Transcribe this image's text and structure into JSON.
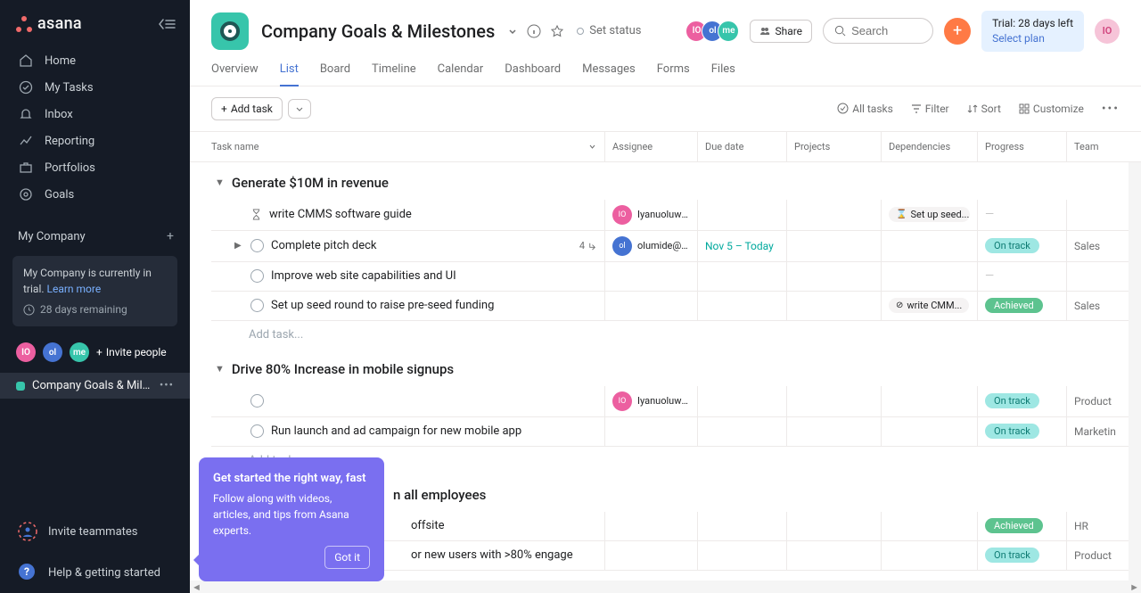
{
  "logo": "asana",
  "nav": {
    "home": "Home",
    "mytasks": "My Tasks",
    "inbox": "Inbox",
    "reporting": "Reporting",
    "portfolios": "Portfolios",
    "goals": "Goals"
  },
  "workspace": {
    "name": "My Company",
    "trial_msg": "My Company is currently in trial. ",
    "learn_more": "Learn more",
    "remaining": "28 days remaining",
    "project": "Company Goals & Mile..."
  },
  "members": [
    {
      "initials": "IO",
      "cls": "av-io"
    },
    {
      "initials": "ol",
      "cls": "av-ol"
    },
    {
      "initials": "me",
      "cls": "av-me"
    }
  ],
  "invite_people": "Invite people",
  "bottom": {
    "invite": "Invite teammates",
    "help": "Help & getting started"
  },
  "header": {
    "title": "Company Goals & Milestones",
    "status": "Set status",
    "share": "Share",
    "search_ph": "Search",
    "trial_line1": "Trial: 28 days left",
    "trial_line2": "Select plan",
    "profile": "IO"
  },
  "tabs": [
    "Overview",
    "List",
    "Board",
    "Timeline",
    "Calendar",
    "Dashboard",
    "Messages",
    "Forms",
    "Files"
  ],
  "active_tab": 1,
  "toolbar": {
    "add": "Add task",
    "alltasks": "All tasks",
    "filter": "Filter",
    "sort": "Sort",
    "customize": "Customize"
  },
  "columns": [
    "Task name",
    "Assignee",
    "Due date",
    "Projects",
    "Dependencies",
    "Progress",
    "Team"
  ],
  "sections": [
    {
      "name": "Generate $10M in revenue",
      "tasks": [
        {
          "icon": "hourglass",
          "name": "write CMMS software guide",
          "assignee": {
            "initials": "IO",
            "cls": "av-io",
            "name": "Iyanuoluwa ..."
          },
          "dep": {
            "icon": "⌛",
            "text": "Set up seed..."
          },
          "progress": "—"
        },
        {
          "icon": "check",
          "expand": true,
          "name": "Complete pitch deck",
          "sub": "4",
          "assignee": {
            "initials": "ol",
            "cls": "av-ol",
            "name": "olumide@g..."
          },
          "due": "Nov 5 – Today",
          "due_cls": "due-teal",
          "progress": "On track",
          "prog_cls": "prog-ontrack",
          "team": "Sales"
        },
        {
          "icon": "check",
          "name": "Improve web site capabilities and UI",
          "progress": "—"
        },
        {
          "icon": "check",
          "name": "Set up seed round to raise pre-seed funding",
          "dep": {
            "icon": "⊘",
            "text": "write CMM..."
          },
          "progress": "Achieved",
          "prog_cls": "prog-achieved",
          "team": "Sales"
        }
      ],
      "add": "Add task..."
    },
    {
      "name": "Drive 80% Increase in mobile signups",
      "tasks": [
        {
          "icon": "check",
          "name": "",
          "assignee": {
            "initials": "IO",
            "cls": "av-io",
            "name": "Iyanuoluwa ..."
          },
          "progress": "On track",
          "prog_cls": "prog-ontrack",
          "team": "Product"
        },
        {
          "icon": "check",
          "name": "Run launch and ad campaign for new mobile app",
          "progress": "On track",
          "prog_cls": "prog-ontrack",
          "team": "Marketin"
        }
      ],
      "add": "Add task..."
    },
    {
      "name": "n all employees",
      "partial": true,
      "tasks": [
        {
          "icon": "none",
          "name": "offsite",
          "progress": "Achieved",
          "prog_cls": "prog-achieved",
          "team": "HR"
        },
        {
          "icon": "none",
          "name": "or new users with >80% engage",
          "progress": "On track",
          "prog_cls": "prog-ontrack",
          "team": "Product"
        }
      ]
    }
  ],
  "popover": {
    "title": "Get started the right way, fast",
    "body": "Follow along with videos, articles, and tips from Asana experts.",
    "btn": "Got it"
  }
}
